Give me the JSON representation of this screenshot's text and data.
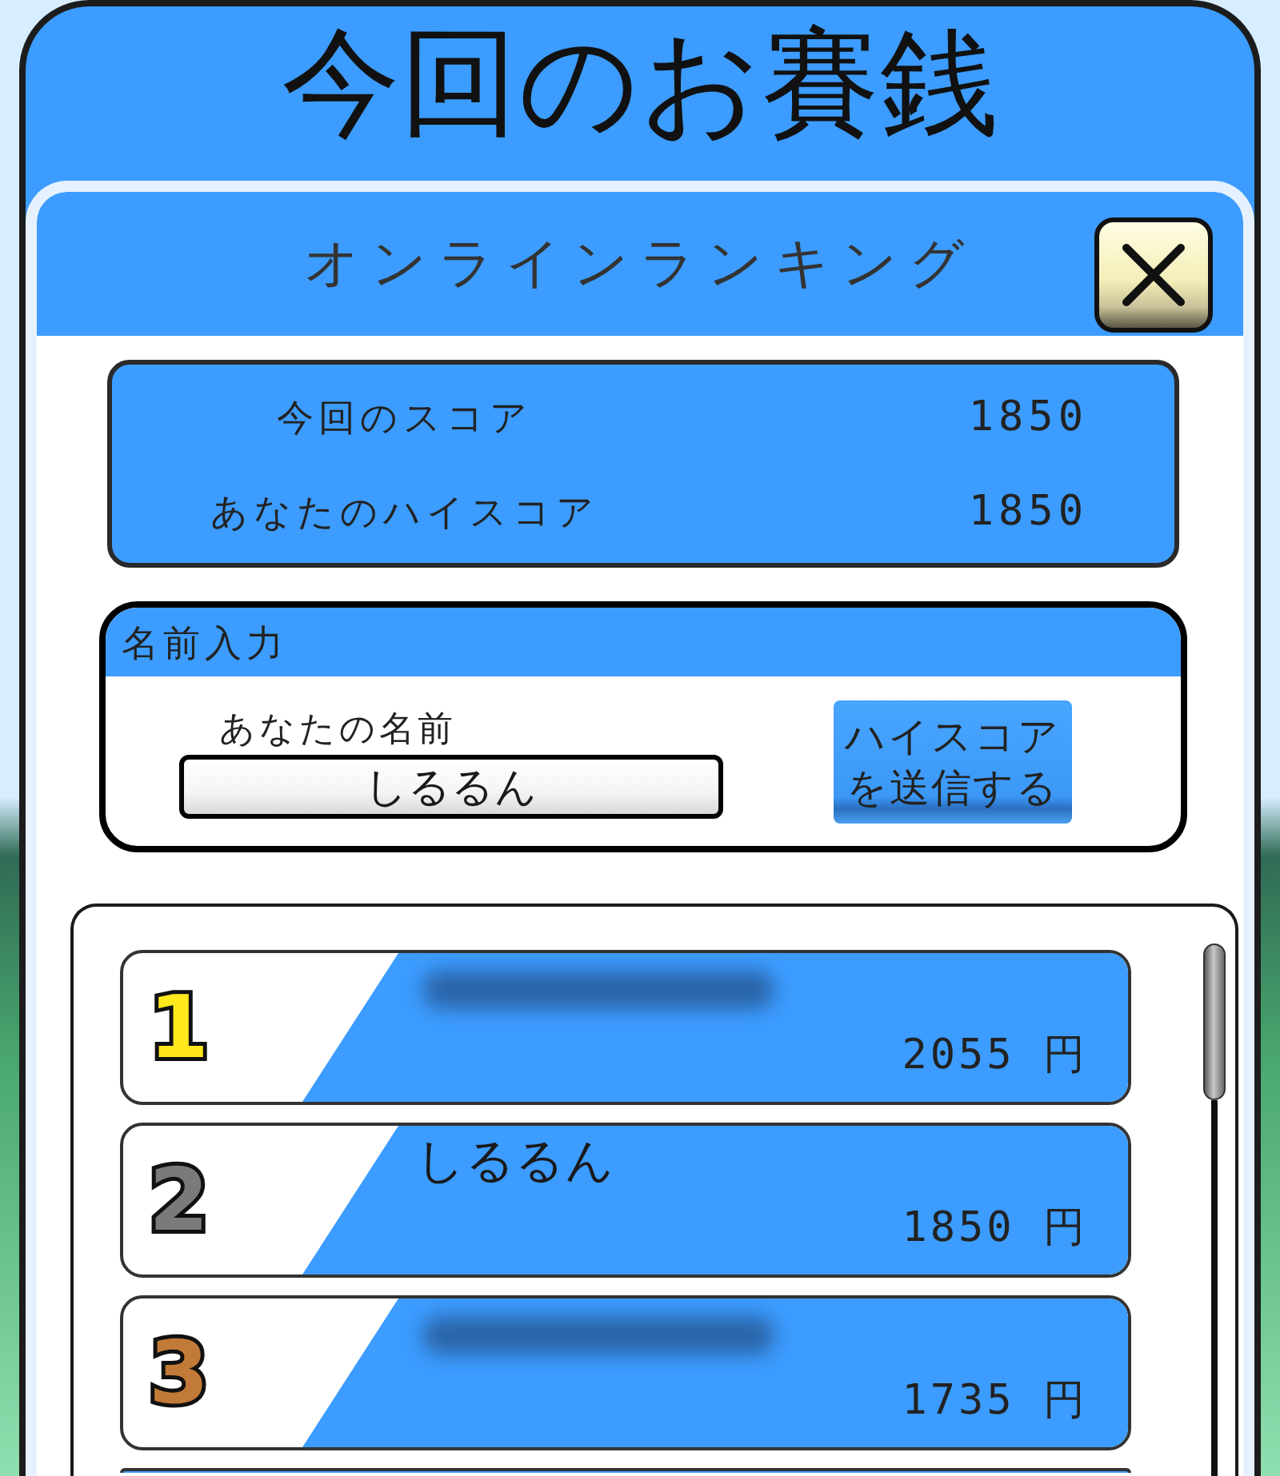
{
  "title": "今回のお賽銭",
  "ranking_dialog": {
    "title": "オンラインランキング",
    "score_summary": [
      {
        "label": "今回のスコア",
        "value": "1850"
      },
      {
        "label": "あなたのハイスコア",
        "value": "1850"
      }
    ],
    "name_entry": {
      "title": "名前入力",
      "label": "あなたの名前",
      "value": "しるるん",
      "submit_button": [
        "ハイスコア",
        "を送信する"
      ]
    },
    "ranking": [
      {
        "rank": "1",
        "color": "#ffe81c",
        "name_blurred": true,
        "amount": "2055 円"
      },
      {
        "rank": "2",
        "color": "#7a7a7a",
        "name_blurred": false,
        "name": "しるるん",
        "amount": "1850 円"
      },
      {
        "rank": "3",
        "color": "#c27a38",
        "name_blurred": true,
        "amount": "1735 円"
      }
    ]
  }
}
